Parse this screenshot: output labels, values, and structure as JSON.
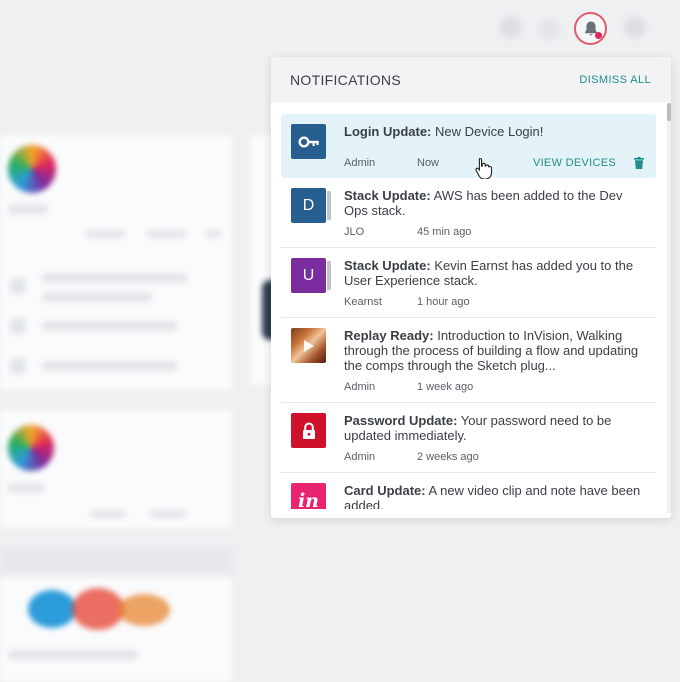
{
  "panel": {
    "title": "NOTIFICATIONS",
    "dismiss_label": "DISMISS ALL"
  },
  "notifications": [
    {
      "type": "Login Update:",
      "message": " New Device Login!",
      "author": "Admin",
      "time": "Now",
      "action": "VIEW DEVICES",
      "icon": "key-icon",
      "color": "#265f8f"
    },
    {
      "type": "Stack Update:",
      "message": " AWS has been added to the Dev Ops stack.",
      "author": "JLO",
      "time": "45 min ago",
      "initial": "D",
      "color": "#265f8f"
    },
    {
      "type": "Stack Update:",
      "message": " Kevin Earnst has added you to the User Experience stack.",
      "author": "Kearnst",
      "time": "1 hour ago",
      "initial": "U",
      "color": "#7b2c9e"
    },
    {
      "type": "Replay Ready:",
      "message": " Introduction to InVision, Walking through the process of building a flow and updating the comps through the Sketch plug...",
      "author": "Admin",
      "time": "1 week ago",
      "icon": "video-thumbnail-icon"
    },
    {
      "type": "Password Update:",
      "message": " Your password need to be updated immediately.",
      "author": "Admin",
      "time": "2 weeks ago",
      "icon": "lock-icon",
      "color": "#d0112b"
    },
    {
      "type": "Card Update:",
      "message": " A new video clip and note have been added.",
      "author": "",
      "time": "",
      "icon": "invision-logo-icon",
      "color": "#e8246e",
      "logo_text": "in"
    }
  ]
}
